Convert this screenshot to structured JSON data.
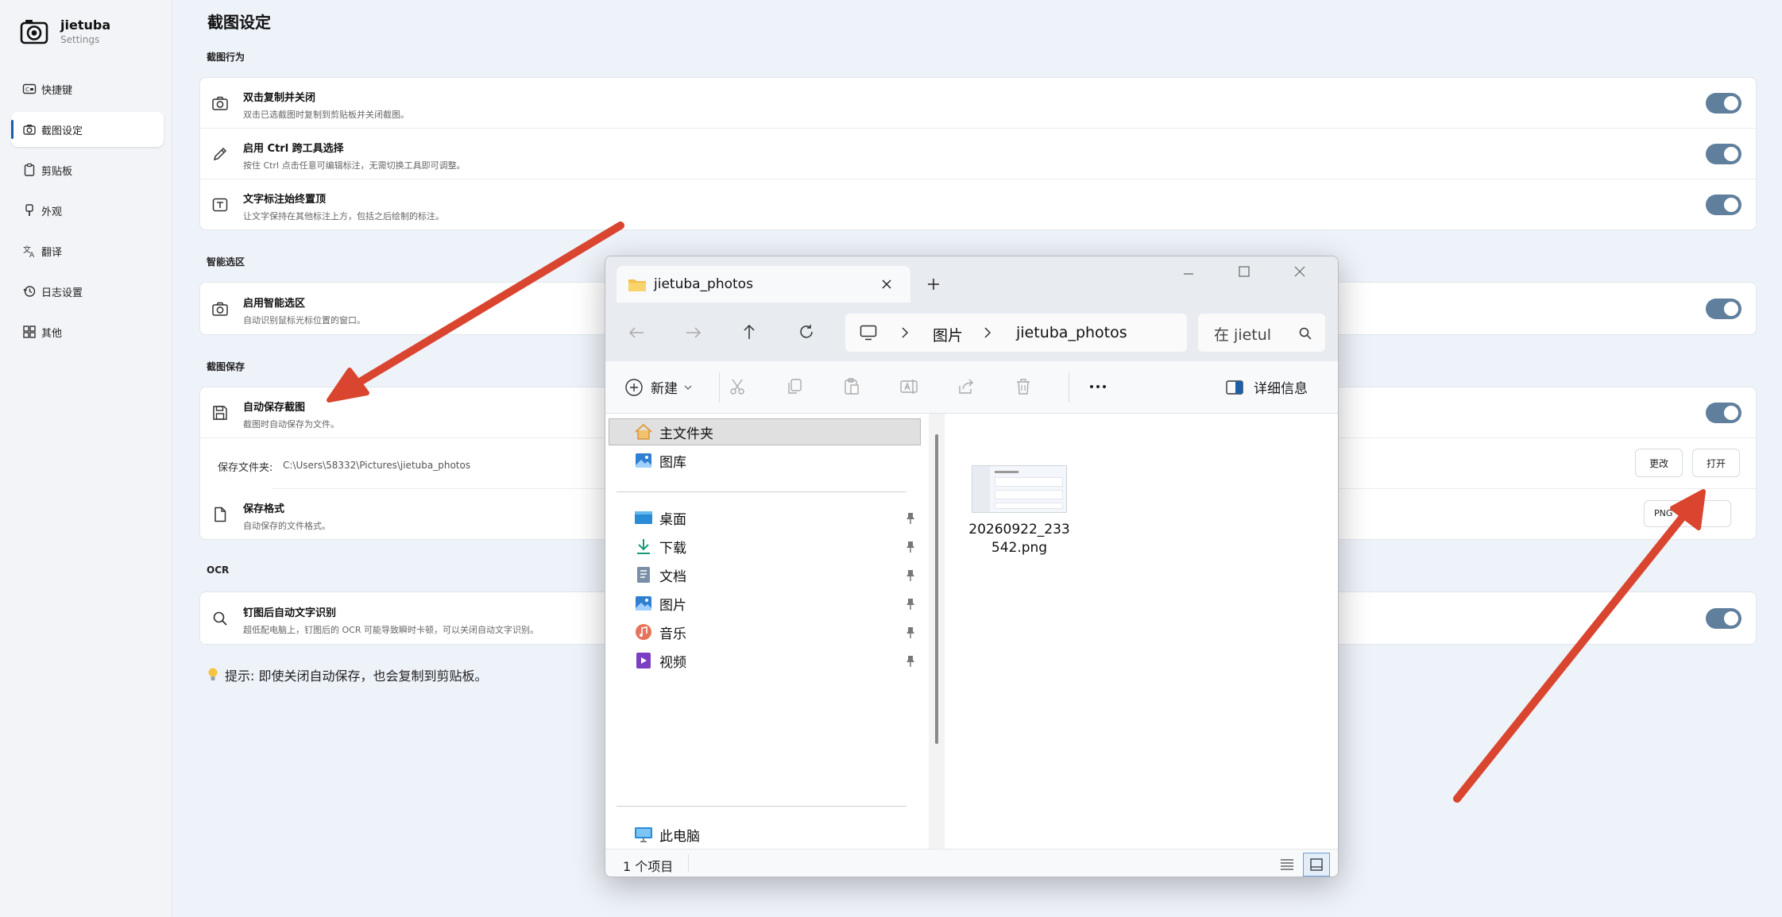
{
  "app": {
    "name": "jietuba",
    "subtitle": "Settings"
  },
  "sidebar": {
    "items": [
      {
        "label": "快捷键",
        "icon": "keyboard-icon"
      },
      {
        "label": "截图设定",
        "icon": "camera-icon",
        "active": true
      },
      {
        "label": "剪贴板",
        "icon": "clipboard-icon"
      },
      {
        "label": "外观",
        "icon": "brush-icon"
      },
      {
        "label": "翻译",
        "icon": "translate-icon"
      },
      {
        "label": "日志设置",
        "icon": "history-icon"
      },
      {
        "label": "其他",
        "icon": "grid-icon"
      }
    ]
  },
  "page": {
    "title": "截图设定"
  },
  "sections": {
    "behavior": {
      "title": "截图行为",
      "rows": [
        {
          "title": "双击复制并关闭",
          "desc": "双击已选截图时复制到剪贴板并关闭截图。",
          "on": true
        },
        {
          "title": "启用 Ctrl 跨工具选择",
          "desc": "按住 Ctrl 点击任意可编辑标注，无需切换工具即可调整。",
          "on": true
        },
        {
          "title": "文字标注始终置顶",
          "desc": "让文字保持在其他标注上方，包括之后绘制的标注。",
          "on": true
        }
      ]
    },
    "smart": {
      "title": "智能选区",
      "rows": [
        {
          "title": "启用智能选区",
          "desc": "自动识别鼠标光标位置的窗口。",
          "on": true
        }
      ]
    },
    "save": {
      "title": "截图保存",
      "auto": {
        "title": "自动保存截图",
        "desc": "截图时自动保存为文件。",
        "on": true
      },
      "folder": {
        "label": "保存文件夹:",
        "value": "C:\\Users\\58332\\Pictures\\jietuba_photos",
        "change": "更改",
        "open": "打开"
      },
      "format": {
        "title": "保存格式",
        "desc": "自动保存的文件格式。",
        "value": "PNG"
      }
    },
    "ocr": {
      "title": "OCR",
      "rows": [
        {
          "title": "钉图后自动文字识别",
          "desc": "超低配电脑上，钉图后的 OCR 可能导致瞬时卡顿，可以关闭自动文字识别。",
          "on": true
        }
      ]
    }
  },
  "tip": "提示: 即使关闭自动保存，也会复制到剪贴板。",
  "explorer": {
    "tab_title": "jietuba_photos",
    "breadcrumb": [
      "图片",
      "jietuba_photos"
    ],
    "search_placeholder": "在 jietul",
    "new_label": "新建",
    "details_label": "详细信息",
    "nav": {
      "top": [
        {
          "label": "主文件夹",
          "icon": "home-icon"
        },
        {
          "label": "图库",
          "icon": "gallery-icon"
        }
      ],
      "pinned": [
        {
          "label": "桌面",
          "icon": "desktop-folder-icon"
        },
        {
          "label": "下载",
          "icon": "download-icon"
        },
        {
          "label": "文档",
          "icon": "document-icon"
        },
        {
          "label": "图片",
          "icon": "pictures-icon"
        },
        {
          "label": "音乐",
          "icon": "music-icon"
        },
        {
          "label": "视频",
          "icon": "video-icon"
        }
      ],
      "bottom": [
        {
          "label": "此电脑",
          "icon": "computer-icon"
        }
      ]
    },
    "files": [
      {
        "name_line1": "20260922_233",
        "name_line2": "542.png"
      }
    ],
    "status": "1 个项目"
  },
  "colors": {
    "accent": "#1b5fa8",
    "toggle": "#607f9c",
    "arrow": "#d9452e"
  }
}
